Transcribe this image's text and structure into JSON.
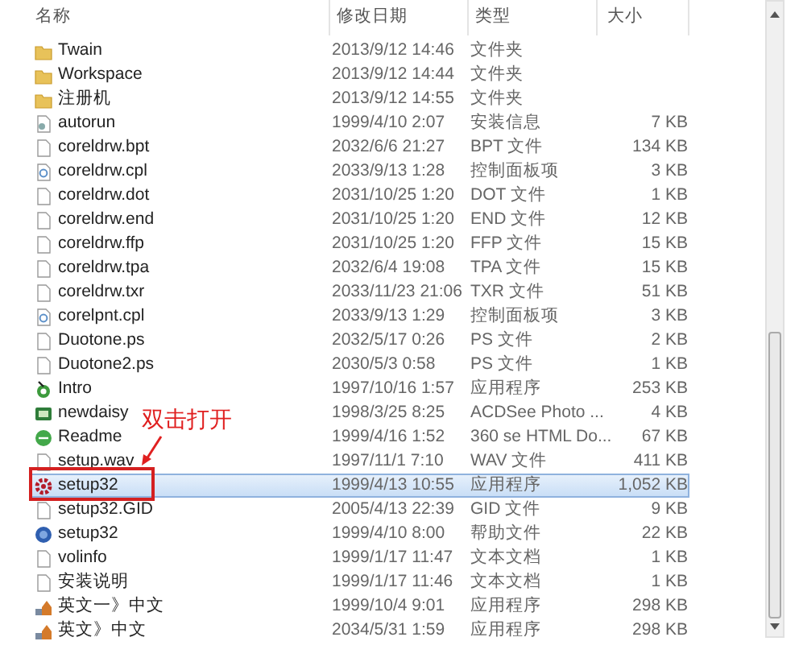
{
  "columns": [
    "名称",
    "修改日期",
    "类型",
    "大小"
  ],
  "files": [
    {
      "kind": "folder",
      "name": "Twain",
      "date": "2013/9/12 14:46",
      "type": "文件夹",
      "selected": false
    },
    {
      "kind": "folder",
      "name": "Workspace",
      "date": "2013/9/12 14:44",
      "type": "文件夹",
      "selected": false
    },
    {
      "kind": "folder",
      "name": "注册机",
      "date": "2013/9/12 14:55",
      "type": "文件夹",
      "selected": false
    },
    {
      "kind": "setupinfo",
      "name": "autorun",
      "date": "1999/4/10 2:07",
      "type": "安装信息",
      "size": "7 KB",
      "selected": false
    },
    {
      "kind": "file",
      "name": "coreldrw.bpt",
      "date": "2032/6/6 21:27",
      "type": "BPT 文件",
      "size": "134 KB",
      "selected": false
    },
    {
      "kind": "cpl",
      "name": "coreldrw.cpl",
      "date": "2033/9/13 1:28",
      "type": "控制面板项",
      "size": "3 KB",
      "selected": false
    },
    {
      "kind": "file",
      "name": "coreldrw.dot",
      "date": "2031/10/25 1:20",
      "type": "DOT 文件",
      "size": "1 KB",
      "selected": false
    },
    {
      "kind": "file",
      "name": "coreldrw.end",
      "date": "2031/10/25 1:20",
      "type": "END 文件",
      "size": "12 KB",
      "selected": false
    },
    {
      "kind": "file",
      "name": "coreldrw.ffp",
      "date": "2031/10/25 1:20",
      "type": "FFP 文件",
      "size": "15 KB",
      "selected": false
    },
    {
      "kind": "file",
      "name": "coreldrw.tpa",
      "date": "2032/6/4 19:08",
      "type": "TPA 文件",
      "size": "15 KB",
      "selected": false
    },
    {
      "kind": "file",
      "name": "coreldrw.txr",
      "date": "2033/11/23 21:06",
      "type": "TXR 文件",
      "size": "51 KB",
      "selected": false
    },
    {
      "kind": "cpl",
      "name": "corelpnt.cpl",
      "date": "2033/9/13 1:29",
      "type": "控制面板项",
      "size": "3 KB",
      "selected": false
    },
    {
      "kind": "file",
      "name": "Duotone.ps",
      "date": "2032/5/17 0:26",
      "type": "PS 文件",
      "size": "2 KB",
      "selected": false
    },
    {
      "kind": "file",
      "name": "Duotone2.ps",
      "date": "2030/5/3 0:58",
      "type": "PS 文件",
      "size": "1 KB",
      "selected": false
    },
    {
      "kind": "app",
      "name": "Intro",
      "date": "1997/10/16 1:57",
      "type": "应用程序",
      "size": "253 KB",
      "selected": false
    },
    {
      "kind": "image",
      "name": "newdaisy",
      "date": "1998/3/25 8:25",
      "type": "ACDSee Photo ...",
      "size": "4 KB",
      "selected": false
    },
    {
      "kind": "web",
      "name": "Readme",
      "date": "1999/4/16 1:52",
      "type": "360 se HTML Do...",
      "size": "67 KB",
      "selected": false
    },
    {
      "kind": "file",
      "name": "setup.wav",
      "date": "1997/11/1 7:10",
      "type": "WAV 文件",
      "size": "411 KB",
      "selected": false
    },
    {
      "kind": "gear",
      "name": "setup32",
      "date": "1999/4/13 10:55",
      "type": "应用程序",
      "size": "1,052 KB",
      "selected": true
    },
    {
      "kind": "file",
      "name": "setup32.GID",
      "date": "2005/4/13 22:39",
      "type": "GID 文件",
      "size": "9 KB",
      "selected": false
    },
    {
      "kind": "help",
      "name": "setup32",
      "date": "1999/4/10 8:00",
      "type": "帮助文件",
      "size": "22 KB",
      "selected": false
    },
    {
      "kind": "file",
      "name": "volinfo",
      "date": "1999/1/17 11:47",
      "type": "文本文档",
      "size": "1 KB",
      "selected": false
    },
    {
      "kind": "file",
      "name": "安装说明",
      "date": "1999/1/17 11:46",
      "type": "文本文档",
      "size": "1 KB",
      "selected": false
    },
    {
      "kind": "installer",
      "name": "英文一》中文",
      "date": "1999/10/4 9:01",
      "type": "应用程序",
      "size": "298 KB",
      "selected": false
    },
    {
      "kind": "installer",
      "name": "英文》中文",
      "date": "2034/5/31 1:59",
      "type": "应用程序",
      "size": "298 KB",
      "selected": false
    }
  ],
  "annotation": {
    "text": "双击打开"
  }
}
